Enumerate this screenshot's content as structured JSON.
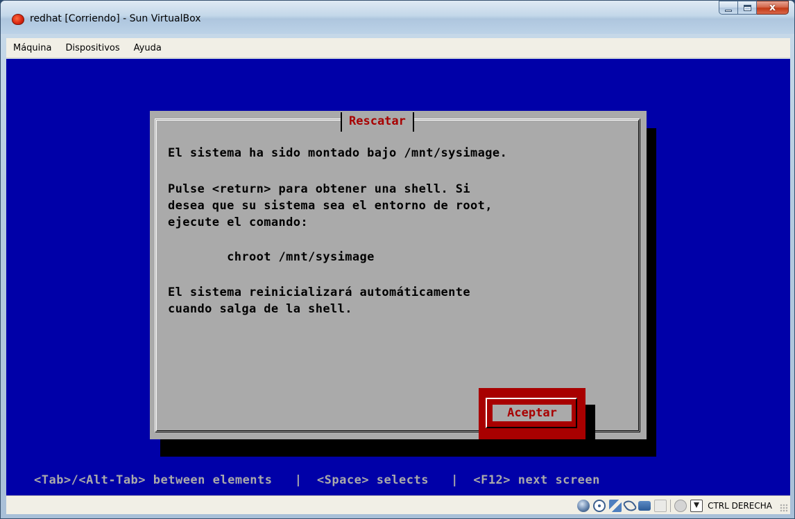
{
  "window": {
    "title": "redhat [Corriendo] - Sun VirtualBox",
    "close_glyph": "x"
  },
  "menubar": {
    "items": [
      "Máquina",
      "Dispositivos",
      "Ayuda"
    ]
  },
  "dialog": {
    "title": "Rescatar",
    "lines": [
      "El sistema ha sido montado bajo /mnt/sysimage.",
      "Pulse <return> para obtener una shell. Si",
      "desea que su sistema sea el entorno de root,",
      "ejecute el comando:",
      "        chroot /mnt/sysimage",
      "El sistema reinicializará automáticamente",
      "cuando salga de la shell."
    ],
    "button_label": "Aceptar"
  },
  "help_line": "<Tab>/<Alt-Tab> between elements   |  <Space> selects   |  <F12> next screen",
  "statusbar": {
    "icons": [
      "hard-disk-icon",
      "cd-rom-icon",
      "network-icon",
      "usb-icon",
      "shared-folders-icon",
      "remote-display-icon",
      "mouse-integration-icon",
      "host-key-icon"
    ],
    "host_key_label": "CTRL DERECHA"
  },
  "colors": {
    "screen_bg": "#0000a8",
    "dialog_bg": "#aaaaaa",
    "accent_red": "#a80000"
  }
}
